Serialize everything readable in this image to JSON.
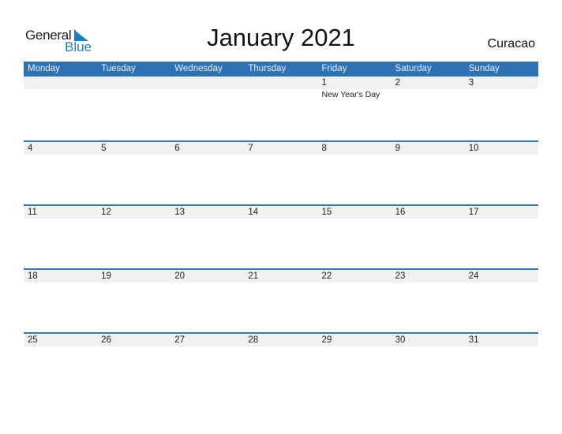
{
  "logo": {
    "general": "General",
    "blue": "Blue",
    "accent_color": "#1f7bc6"
  },
  "title": "January 2021",
  "country": "Curacao",
  "header_color": "#2e72b4",
  "weekdays": [
    "Monday",
    "Tuesday",
    "Wednesday",
    "Thursday",
    "Friday",
    "Saturday",
    "Sunday"
  ],
  "weeks": [
    {
      "days": [
        "",
        "",
        "",
        "",
        "1",
        "2",
        "3"
      ],
      "events": [
        "",
        "",
        "",
        "",
        "New Year's Day",
        "",
        ""
      ]
    },
    {
      "days": [
        "4",
        "5",
        "6",
        "7",
        "8",
        "9",
        "10"
      ],
      "events": [
        "",
        "",
        "",
        "",
        "",
        "",
        ""
      ]
    },
    {
      "days": [
        "11",
        "12",
        "13",
        "14",
        "15",
        "16",
        "17"
      ],
      "events": [
        "",
        "",
        "",
        "",
        "",
        "",
        ""
      ]
    },
    {
      "days": [
        "18",
        "19",
        "20",
        "21",
        "22",
        "23",
        "24"
      ],
      "events": [
        "",
        "",
        "",
        "",
        "",
        "",
        ""
      ]
    },
    {
      "days": [
        "25",
        "26",
        "27",
        "28",
        "29",
        "30",
        "31"
      ],
      "events": [
        "",
        "",
        "",
        "",
        "",
        "",
        ""
      ]
    }
  ]
}
